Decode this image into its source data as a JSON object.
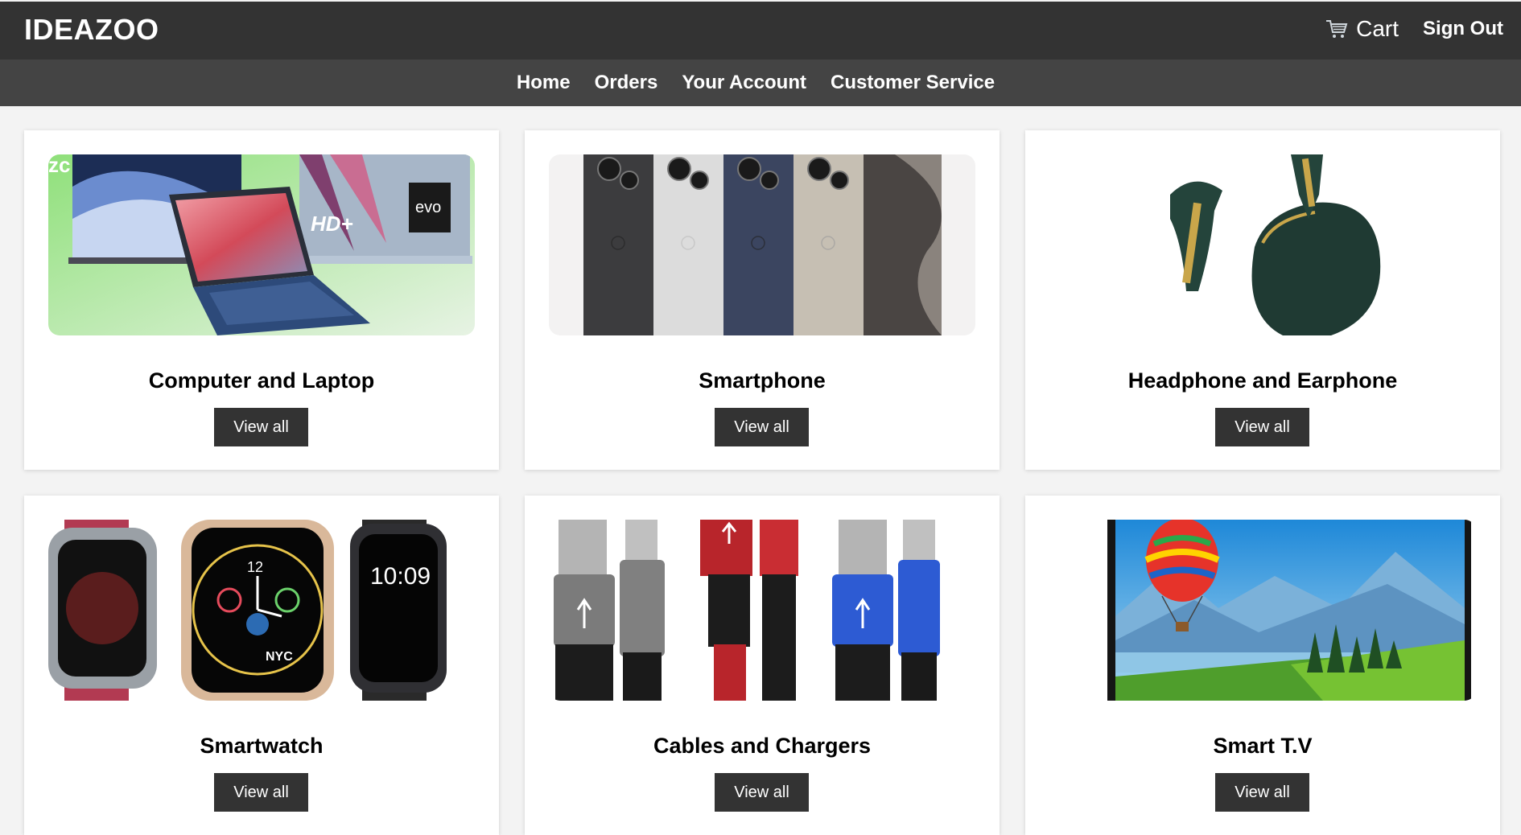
{
  "header": {
    "logo": "IDEAZOO",
    "cart_label": "Cart",
    "sign_out_label": "Sign Out"
  },
  "nav": {
    "items": [
      "Home",
      "Orders",
      "Your Account",
      "Customer Service"
    ]
  },
  "categories": [
    {
      "title": "Computer and Laptop",
      "button": "View all",
      "image": "laptops-image"
    },
    {
      "title": "Smartphone",
      "button": "View all",
      "image": "smartphones-image"
    },
    {
      "title": "Headphone and Earphone",
      "button": "View all",
      "image": "earbuds-image"
    },
    {
      "title": "Smartwatch",
      "button": "View all",
      "image": "smartwatches-image"
    },
    {
      "title": "Cables and Chargers",
      "button": "View all",
      "image": "cables-image"
    },
    {
      "title": "Smart T.V",
      "button": "View all",
      "image": "tv-image"
    }
  ],
  "colors": {
    "header_bg": "#333333",
    "nav_bg": "#444444",
    "page_bg": "#f3f3f3",
    "button_bg": "#333333"
  }
}
